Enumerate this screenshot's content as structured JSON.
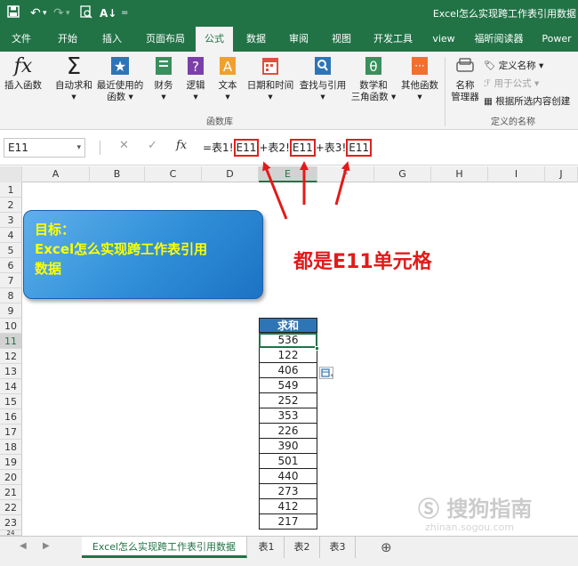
{
  "app": {
    "title": "Excel怎么实现跨工作表引用数据"
  },
  "quick_access": {
    "save_icon": "save-icon",
    "undo_icon": "undo-icon",
    "redo_icon": "redo-icon",
    "preview_icon": "print-preview-icon",
    "sort_icon": "sort-icon",
    "more": "▾"
  },
  "tabs": [
    {
      "label": "文件"
    },
    {
      "label": "开始"
    },
    {
      "label": "插入"
    },
    {
      "label": "页面布局"
    },
    {
      "label": "公式"
    },
    {
      "label": "数据"
    },
    {
      "label": "审阅"
    },
    {
      "label": "视图"
    },
    {
      "label": "开发工具"
    },
    {
      "label": "view"
    },
    {
      "label": "福昕阅读器"
    },
    {
      "label": "Power"
    }
  ],
  "ribbon": {
    "insert_function": "插入函数",
    "autosum": "自动求和",
    "recent": "最近使用的",
    "recent2": "函数",
    "finance": "财务",
    "logic": "逻辑",
    "text": "文本",
    "datetime": "日期和时间",
    "lookup": "查找与引用",
    "math": "数学和",
    "math2": "三角函数",
    "other": "其他函数",
    "group_library": "函数库",
    "name_manager": "名称",
    "name_manager2": "管理器",
    "define_name": "定义名称",
    "use_in_formula": "用于公式",
    "create_from_selection": "根据所选内容创建",
    "group_defined_names": "定义的名称"
  },
  "formula_bar": {
    "name_box": "E11",
    "cancel_glyph": "✕",
    "enter_glyph": "✓",
    "fx_glyph": "fx",
    "formula_parts": [
      "=表1!",
      "E11",
      "+表2!",
      "E11",
      "+表3!",
      "E11"
    ]
  },
  "columns": [
    "A",
    "B",
    "C",
    "D",
    "E",
    "F",
    "G",
    "H",
    "I",
    "J"
  ],
  "rows": [
    "1",
    "2",
    "3",
    "4",
    "5",
    "6",
    "7",
    "8",
    "9",
    "10",
    "11",
    "12",
    "13",
    "14",
    "15",
    "16",
    "17",
    "18",
    "19",
    "20",
    "21",
    "22",
    "23",
    "24"
  ],
  "callout": {
    "line1": "目标：",
    "line2": "Excel怎么实现跨工作表引用",
    "line3": "数据"
  },
  "annotation": "都是E11单元格",
  "table": {
    "header": "求和",
    "values": [
      "536",
      "122",
      "406",
      "549",
      "252",
      "353",
      "226",
      "390",
      "501",
      "440",
      "273",
      "412",
      "217"
    ]
  },
  "sheets": [
    {
      "label": "Excel怎么实现跨工作表引用数据"
    },
    {
      "label": "表1"
    },
    {
      "label": "表2"
    },
    {
      "label": "表3"
    }
  ],
  "add_sheet_glyph": "⊕",
  "watermark": "搜狗指南",
  "watermark_sub": "zhinan.sogou.com",
  "colors": {
    "excel_green": "#217346",
    "header_blue": "#2e75b6",
    "annotation_red": "#e21a1a",
    "callout_text": "#ffff00"
  }
}
